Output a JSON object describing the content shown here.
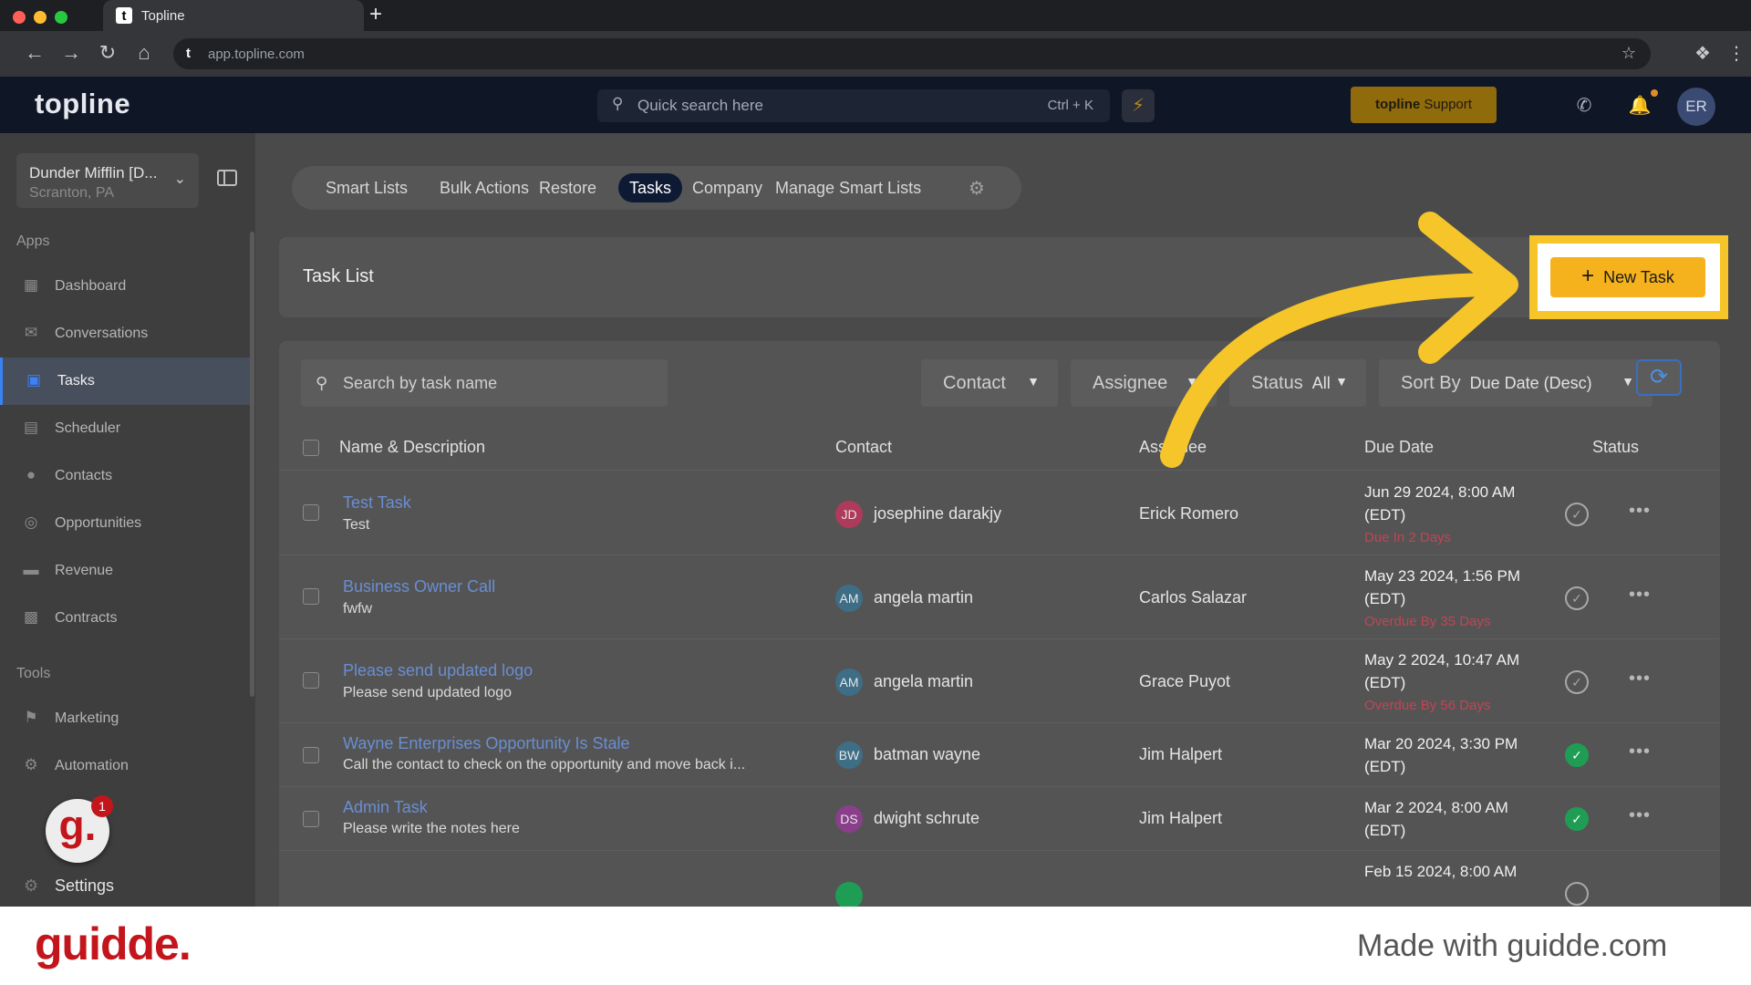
{
  "browser": {
    "tab_title": "Topline",
    "url": "app.topline.com",
    "new_tab": "+"
  },
  "header": {
    "logo": "topline",
    "search_placeholder": "Quick search here",
    "search_shortcut": "Ctrl + K",
    "support_brand": "topline",
    "support_label": "Support",
    "avatar_initials": "ER"
  },
  "sidebar": {
    "location_name": "Dunder Mifflin [D...",
    "location_sub": "Scranton, PA",
    "apps_title": "Apps",
    "apps": [
      {
        "label": "Dashboard",
        "icon": "dashboard-icon"
      },
      {
        "label": "Conversations",
        "icon": "chat-icon"
      },
      {
        "label": "Tasks",
        "icon": "tasks-icon"
      },
      {
        "label": "Scheduler",
        "icon": "calendar-icon"
      },
      {
        "label": "Contacts",
        "icon": "person-icon"
      },
      {
        "label": "Opportunities",
        "icon": "target-icon"
      },
      {
        "label": "Revenue",
        "icon": "card-icon"
      },
      {
        "label": "Contracts",
        "icon": "document-icon"
      }
    ],
    "tools_title": "Tools",
    "tools": [
      {
        "label": "Marketing",
        "icon": "megaphone-icon"
      },
      {
        "label": "Automation",
        "icon": "gears-icon"
      }
    ],
    "guidde_badge": "g.",
    "guidde_count": "1",
    "settings_label": "Settings"
  },
  "subtabs": [
    "Smart Lists",
    "Bulk Actions",
    "Restore",
    "Tasks",
    "Company",
    "Manage Smart Lists"
  ],
  "task_list": {
    "title": "Task List",
    "new_task_label": "New Task",
    "search_placeholder": "Search by task name",
    "filters": {
      "contact": "Contact",
      "assignee": "Assignee",
      "status_label": "Status",
      "status_value": "All",
      "sort_label": "Sort By",
      "sort_value": "Due Date (Desc)"
    },
    "columns": [
      "Name & Description",
      "Contact",
      "Assignee",
      "Due Date",
      "Status"
    ],
    "rows": [
      {
        "name": "Test Task",
        "desc": "Test",
        "initials": "JD",
        "avatar_color": "#b03a5b",
        "contact": "josephine darakjy",
        "assignee": "Erick Romero",
        "due1": "Jun 29 2024, 8:00 AM",
        "due2": "(EDT)",
        "due_note": "Due In 2 Days",
        "status": "open"
      },
      {
        "name": "Business Owner Call",
        "desc": "fwfw",
        "initials": "AM",
        "avatar_color": "#3e6e86",
        "contact": "angela martin",
        "assignee": "Carlos Salazar",
        "due1": "May 23 2024, 1:56 PM",
        "due2": "(EDT)",
        "due_note": "Overdue By 35 Days",
        "status": "open"
      },
      {
        "name": "Please send updated logo",
        "desc": "Please send updated logo",
        "initials": "AM",
        "avatar_color": "#3e6e86",
        "contact": "angela martin",
        "assignee": "Grace Puyot",
        "due1": "May 2 2024, 10:47 AM",
        "due2": "(EDT)",
        "due_note": "Overdue By 56 Days",
        "status": "open"
      },
      {
        "name": "Wayne Enterprises Opportunity Is Stale",
        "desc": "Call the contact to check on the opportunity and move back i...",
        "initials": "BW",
        "avatar_color": "#3e6e86",
        "contact": "batman wayne",
        "assignee": "Jim Halpert",
        "due1": "Mar 20 2024, 3:30 PM",
        "due2": "(EDT)",
        "due_note": "",
        "status": "done"
      },
      {
        "name": "Admin Task",
        "desc": "Please write the notes here",
        "initials": "DS",
        "avatar_color": "#8a3f8a",
        "contact": "dwight schrute",
        "assignee": "Jim Halpert",
        "due1": "Mar 2 2024, 8:00 AM",
        "due2": "(EDT)",
        "due_note": "",
        "status": "done"
      },
      {
        "name": "",
        "desc": "",
        "initials": "",
        "avatar_color": "#1f9d55",
        "contact": "",
        "assignee": "",
        "due1": "Feb 15 2024, 8:00 AM",
        "due2": "",
        "due_note": "",
        "status": "partial"
      }
    ]
  },
  "colors": {
    "accent_yellow": "#f5b21c",
    "highlight_frame": "#f5c52a",
    "link_blue": "#6a8ed1",
    "overdue_red": "#c24455",
    "done_green": "#1f9d55"
  },
  "footer": {
    "brand": "guidde.",
    "made_with": "Made with guidde.com"
  }
}
